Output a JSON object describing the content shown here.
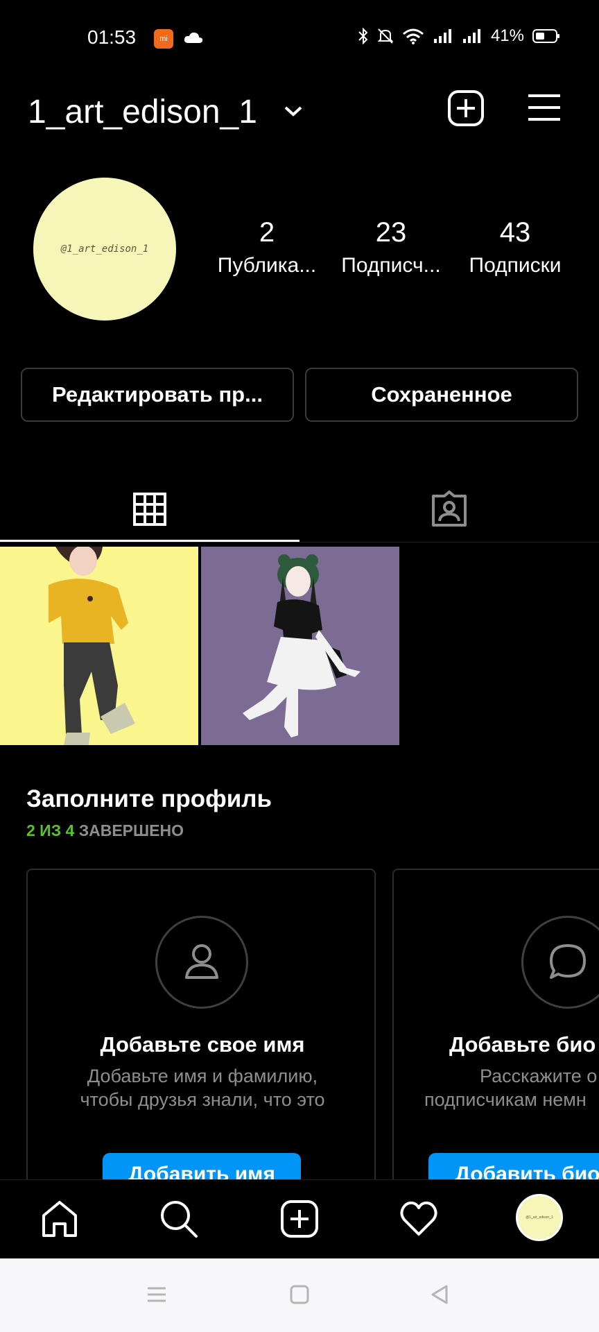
{
  "status_bar": {
    "time": "01:53",
    "mi_label": "mi",
    "battery": "41%"
  },
  "header": {
    "username": "1_art_edison_1"
  },
  "profile": {
    "avatar_text": "@1_art_edison_1",
    "stats": [
      {
        "count": "2",
        "label": "Публика..."
      },
      {
        "count": "23",
        "label": "Подписч..."
      },
      {
        "count": "43",
        "label": "Подписки"
      }
    ],
    "edit_button": "Редактировать пр...",
    "saved_button": "Сохраненное"
  },
  "tabs": [
    {
      "name": "grid",
      "icon": "grid-icon",
      "active": true
    },
    {
      "name": "tagged",
      "icon": "tagged-person-icon",
      "active": false
    }
  ],
  "complete_profile": {
    "title": "Заполните профиль",
    "progress_done": "2 ИЗ 4",
    "progress_rest": "ЗАВЕРШЕНО",
    "cards": [
      {
        "title": "Добавьте свое имя",
        "desc_line1": "Добавьте имя и фамилию,",
        "desc_line2": "чтобы друзья знали, что это",
        "button": "Добавить имя",
        "icon": "person-outline-icon"
      },
      {
        "title": "Добавьте био",
        "desc_line1": "Расскажите о",
        "desc_line2": "подписчикам немн",
        "button": "Добавить био",
        "icon": "speech-bubble-icon"
      }
    ]
  },
  "colors": {
    "background": "#000000",
    "accent_blue": "#0095f6",
    "progress_green": "#58c322",
    "avatar_yellow": "#f5f6b8"
  }
}
